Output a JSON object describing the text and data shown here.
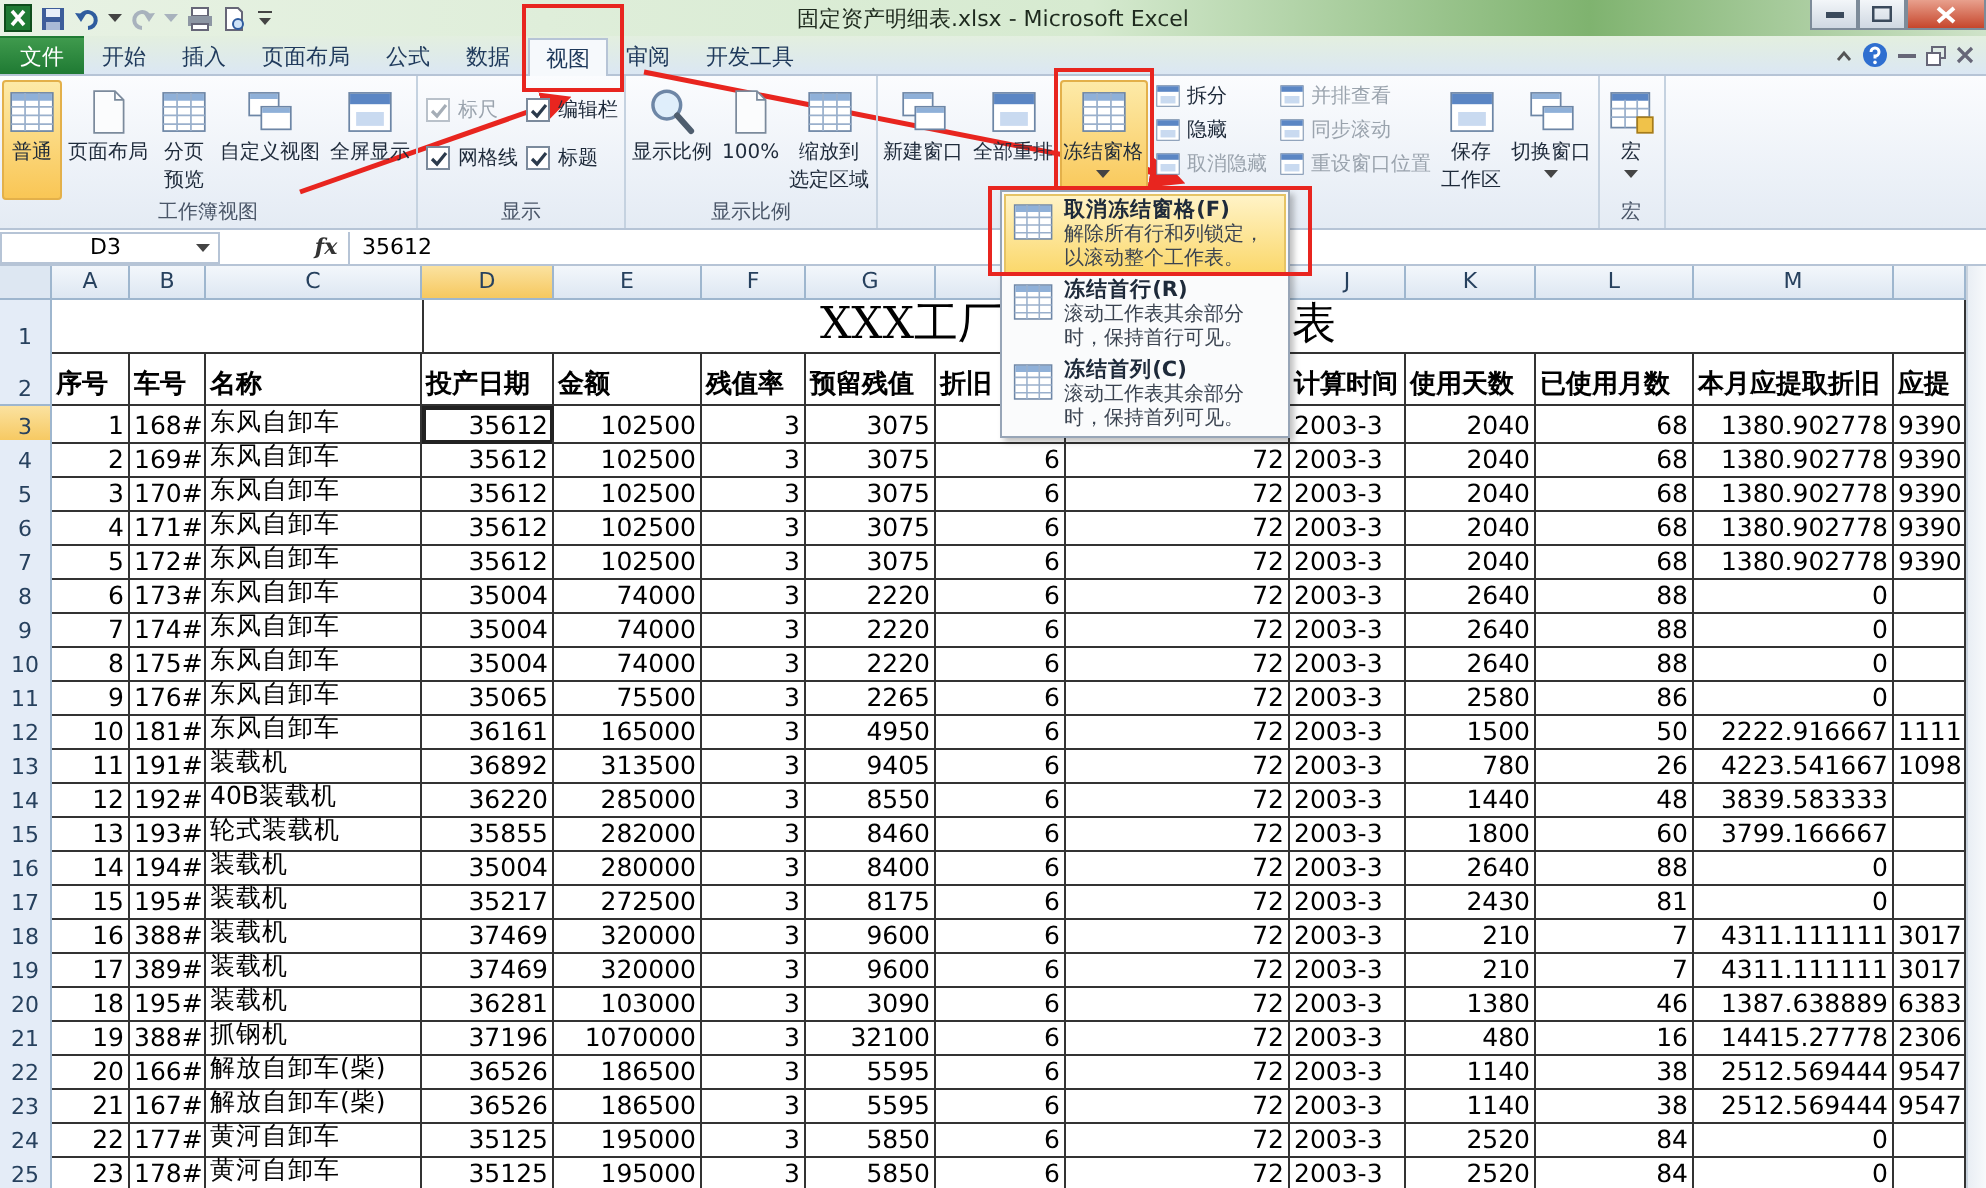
{
  "title_bar": {
    "title": "固定资产明细表.xlsx - Microsoft Excel"
  },
  "ribbon_tabs": [
    {
      "label": "文件",
      "kind": "file",
      "selected": false
    },
    {
      "label": "开始",
      "kind": "tab",
      "selected": false
    },
    {
      "label": "插入",
      "kind": "tab",
      "selected": false
    },
    {
      "label": "页面布局",
      "kind": "tab",
      "selected": false
    },
    {
      "label": "公式",
      "kind": "tab",
      "selected": false
    },
    {
      "label": "数据",
      "kind": "tab",
      "selected": false
    },
    {
      "label": "视图",
      "kind": "tab",
      "selected": true
    },
    {
      "label": "审阅",
      "kind": "tab",
      "selected": false
    },
    {
      "label": "开发工具",
      "kind": "tab",
      "selected": false
    }
  ],
  "ribbon_groups": [
    {
      "kind": "buttons",
      "label": "工作簿视图",
      "items": [
        {
          "kind": "large",
          "lines": [
            "普通"
          ],
          "selected": true,
          "has_menu": false
        },
        {
          "kind": "large",
          "lines": [
            "页面布局"
          ],
          "selected": false,
          "has_menu": false
        },
        {
          "kind": "large",
          "lines": [
            "分页",
            "预览"
          ],
          "selected": false,
          "has_menu": false
        },
        {
          "kind": "large",
          "lines": [
            "自定义视图"
          ],
          "selected": false,
          "has_menu": false
        },
        {
          "kind": "large",
          "lines": [
            "全屏显示"
          ],
          "selected": false,
          "has_menu": false
        }
      ]
    },
    {
      "kind": "checkboxes",
      "label": "显示",
      "items": [
        {
          "label": "标尺",
          "checked": true,
          "disabled": true
        },
        {
          "label": "编辑栏",
          "checked": true,
          "disabled": false
        },
        {
          "label": "网格线",
          "checked": true,
          "disabled": false
        },
        {
          "label": "标题",
          "checked": true,
          "disabled": false
        }
      ]
    },
    {
      "kind": "buttons",
      "label": "显示比例",
      "items": [
        {
          "kind": "large",
          "lines": [
            "显示比例"
          ],
          "selected": false,
          "has_menu": false
        },
        {
          "kind": "large",
          "lines": [
            "100%"
          ],
          "selected": false,
          "has_menu": false
        },
        {
          "kind": "large",
          "lines": [
            "缩放到",
            "选定区域"
          ],
          "selected": false,
          "has_menu": false
        }
      ]
    },
    {
      "kind": "buttons",
      "items": [
        {
          "kind": "large",
          "lines": [
            "新建窗口"
          ],
          "selected": false,
          "has_menu": false
        },
        {
          "kind": "large",
          "lines": [
            "全部重排"
          ],
          "selected": false,
          "has_menu": false
        },
        {
          "kind": "large",
          "lines": [
            "冻结窗格"
          ],
          "selected": true,
          "has_menu": true
        },
        {
          "kind": "small",
          "label": "拆分",
          "disabled": false
        },
        {
          "kind": "small",
          "label": "隐藏",
          "disabled": false
        },
        {
          "kind": "small",
          "label": "取消隐藏",
          "disabled": true
        },
        {
          "kind": "small",
          "label": "并排查看",
          "disabled": true
        },
        {
          "kind": "small",
          "label": "同步滚动",
          "disabled": true
        },
        {
          "kind": "small",
          "label": "重设窗口位置",
          "disabled": true
        },
        {
          "kind": "large",
          "lines": [
            "保存",
            "工作区"
          ],
          "selected": false,
          "has_menu": false
        },
        {
          "kind": "large",
          "lines": [
            "切换窗口"
          ],
          "selected": false,
          "has_menu": true
        }
      ]
    },
    {
      "kind": "buttons",
      "label": "宏",
      "items": [
        {
          "kind": "large",
          "lines": [
            "宏"
          ],
          "selected": false,
          "has_menu": true
        }
      ]
    }
  ],
  "formula_bar": {
    "name_box": "D3",
    "function_button": "fx",
    "content": "35612"
  },
  "freeze_menu": {
    "items": [
      {
        "title": "取消冻结窗格(F)",
        "description": "解除所有行和列锁定，以滚动整个工作表。",
        "selected": true
      },
      {
        "title": "冻结首行(R)",
        "description": "滚动工作表其余部分时，保持首行可见。",
        "selected": false
      },
      {
        "title": "冻结首列(C)",
        "description": "滚动工作表其余部分时，保持首列可见。",
        "selected": false
      }
    ]
  },
  "sheet": {
    "columns": [
      {
        "letter": "A",
        "selected": false
      },
      {
        "letter": "B",
        "selected": false
      },
      {
        "letter": "C",
        "selected": false
      },
      {
        "letter": "D",
        "selected": true
      },
      {
        "letter": "E",
        "selected": false
      },
      {
        "letter": "F",
        "selected": false
      },
      {
        "letter": "G",
        "selected": false
      },
      {
        "selected": false
      },
      null,
      {
        "letter": "J",
        "selected": false
      },
      {
        "letter": "K",
        "selected": false
      },
      {
        "letter": "L",
        "selected": false
      },
      {
        "letter": "M",
        "selected": false
      },
      {
        "selected": false
      }
    ],
    "rows": [
      {
        "number": "1",
        "kind": "title",
        "selected": false,
        "title_parts": [
          "XXX工厂",
          "表"
        ]
      },
      {
        "number": "2",
        "kind": "header",
        "selected": false,
        "cells": [
          "序号",
          "车号",
          "名称",
          "投产日期",
          "金额",
          "残值率",
          "预留残值",
          "折旧",
          null,
          "计算时间",
          "使用天数",
          "已使用月数",
          "本月应提取折旧",
          "应提"
        ]
      },
      {
        "number": "3",
        "kind": "data",
        "selected": true,
        "cells": [
          "1",
          "168#",
          "东风自卸车",
          "35612",
          "102500",
          "3",
          "3075",
          null,
          null,
          "2003-3",
          "2040",
          "68",
          "1380.902778",
          "9390"
        ]
      },
      {
        "number": "4",
        "kind": "data",
        "selected": false,
        "cells": [
          "2",
          "169#",
          "东风自卸车",
          "35612",
          "102500",
          "3",
          "3075",
          "6",
          "72",
          "2003-3",
          "2040",
          "68",
          "1380.902778",
          "9390"
        ]
      },
      {
        "number": "5",
        "kind": "data",
        "selected": false,
        "cells": [
          "3",
          "170#",
          "东风自卸车",
          "35612",
          "102500",
          "3",
          "3075",
          "6",
          "72",
          "2003-3",
          "2040",
          "68",
          "1380.902778",
          "9390"
        ]
      },
      {
        "number": "6",
        "kind": "data",
        "selected": false,
        "cells": [
          "4",
          "171#",
          "东风自卸车",
          "35612",
          "102500",
          "3",
          "3075",
          "6",
          "72",
          "2003-3",
          "2040",
          "68",
          "1380.902778",
          "9390"
        ]
      },
      {
        "number": "7",
        "kind": "data",
        "selected": false,
        "cells": [
          "5",
          "172#",
          "东风自卸车",
          "35612",
          "102500",
          "3",
          "3075",
          "6",
          "72",
          "2003-3",
          "2040",
          "68",
          "1380.902778",
          "9390"
        ]
      },
      {
        "number": "8",
        "kind": "data",
        "selected": false,
        "cells": [
          "6",
          "173#",
          "东风自卸车",
          "35004",
          "74000",
          "3",
          "2220",
          "6",
          "72",
          "2003-3",
          "2640",
          "88",
          "0",
          null
        ]
      },
      {
        "number": "9",
        "kind": "data",
        "selected": false,
        "cells": [
          "7",
          "174#",
          "东风自卸车",
          "35004",
          "74000",
          "3",
          "2220",
          "6",
          "72",
          "2003-3",
          "2640",
          "88",
          "0",
          null
        ]
      },
      {
        "number": "10",
        "kind": "data",
        "selected": false,
        "cells": [
          "8",
          "175#",
          "东风自卸车",
          "35004",
          "74000",
          "3",
          "2220",
          "6",
          "72",
          "2003-3",
          "2640",
          "88",
          "0",
          null
        ]
      },
      {
        "number": "11",
        "kind": "data",
        "selected": false,
        "cells": [
          "9",
          "176#",
          "东风自卸车",
          "35065",
          "75500",
          "3",
          "2265",
          "6",
          "72",
          "2003-3",
          "2580",
          "86",
          "0",
          null
        ]
      },
      {
        "number": "12",
        "kind": "data",
        "selected": false,
        "cells": [
          "10",
          "181#",
          "东风自卸车",
          "36161",
          "165000",
          "3",
          "4950",
          "6",
          "72",
          "2003-3",
          "1500",
          "50",
          "2222.916667",
          "1111"
        ]
      },
      {
        "number": "13",
        "kind": "data",
        "selected": false,
        "cells": [
          "11",
          "191#",
          "装载机",
          "36892",
          "313500",
          "3",
          "9405",
          "6",
          "72",
          "2003-3",
          "780",
          "26",
          "4223.541667",
          "1098"
        ]
      },
      {
        "number": "14",
        "kind": "data",
        "selected": false,
        "cells": [
          "12",
          "192#",
          "40B装载机",
          "36220",
          "285000",
          "3",
          "8550",
          "6",
          "72",
          "2003-3",
          "1440",
          "48",
          "3839.583333",
          null
        ]
      },
      {
        "number": "15",
        "kind": "data",
        "selected": false,
        "cells": [
          "13",
          "193#",
          "轮式装载机",
          "35855",
          "282000",
          "3",
          "8460",
          "6",
          "72",
          "2003-3",
          "1800",
          "60",
          "3799.166667",
          null
        ]
      },
      {
        "number": "16",
        "kind": "data",
        "selected": false,
        "cells": [
          "14",
          "194#",
          "装载机",
          "35004",
          "280000",
          "3",
          "8400",
          "6",
          "72",
          "2003-3",
          "2640",
          "88",
          "0",
          null
        ]
      },
      {
        "number": "17",
        "kind": "data",
        "selected": false,
        "cells": [
          "15",
          "195#",
          "装载机",
          "35217",
          "272500",
          "3",
          "8175",
          "6",
          "72",
          "2003-3",
          "2430",
          "81",
          "0",
          null
        ]
      },
      {
        "number": "18",
        "kind": "data",
        "selected": false,
        "cells": [
          "16",
          "388#",
          "装载机",
          "37469",
          "320000",
          "3",
          "9600",
          "6",
          "72",
          "2003-3",
          "210",
          "7",
          "4311.111111",
          "3017"
        ]
      },
      {
        "number": "19",
        "kind": "data",
        "selected": false,
        "cells": [
          "17",
          "389#",
          "装载机",
          "37469",
          "320000",
          "3",
          "9600",
          "6",
          "72",
          "2003-3",
          "210",
          "7",
          "4311.111111",
          "3017"
        ]
      },
      {
        "number": "20",
        "kind": "data",
        "selected": false,
        "cells": [
          "18",
          "195#",
          "装载机",
          "36281",
          "103000",
          "3",
          "3090",
          "6",
          "72",
          "2003-3",
          "1380",
          "46",
          "1387.638889",
          "6383"
        ]
      },
      {
        "number": "21",
        "kind": "data",
        "selected": false,
        "cells": [
          "19",
          "388#",
          "抓钢机",
          "37196",
          "1070000",
          "3",
          "32100",
          "6",
          "72",
          "2003-3",
          "480",
          "16",
          "14415.27778",
          "2306"
        ]
      },
      {
        "number": "22",
        "kind": "data",
        "selected": false,
        "cells": [
          "20",
          "166#",
          "解放自卸车(柴)",
          "36526",
          "186500",
          "3",
          "5595",
          "6",
          "72",
          "2003-3",
          "1140",
          "38",
          "2512.569444",
          "9547"
        ]
      },
      {
        "number": "23",
        "kind": "data",
        "selected": false,
        "cells": [
          "21",
          "167#",
          "解放自卸车(柴)",
          "36526",
          "186500",
          "3",
          "5595",
          "6",
          "72",
          "2003-3",
          "1140",
          "38",
          "2512.569444",
          "9547"
        ]
      },
      {
        "number": "24",
        "kind": "data",
        "selected": false,
        "cells": [
          "22",
          "177#",
          "黄河自卸车",
          "35125",
          "195000",
          "3",
          "5850",
          "6",
          "72",
          "2003-3",
          "2520",
          "84",
          "0",
          null
        ]
      },
      {
        "number": "25",
        "kind": "data",
        "selected": false,
        "cells": [
          "23",
          "178#",
          "黄河自卸车",
          "35125",
          "195000",
          "3",
          "5850",
          "6",
          "72",
          "2003-3",
          "2520",
          "84",
          "0",
          null
        ]
      }
    ]
  }
}
